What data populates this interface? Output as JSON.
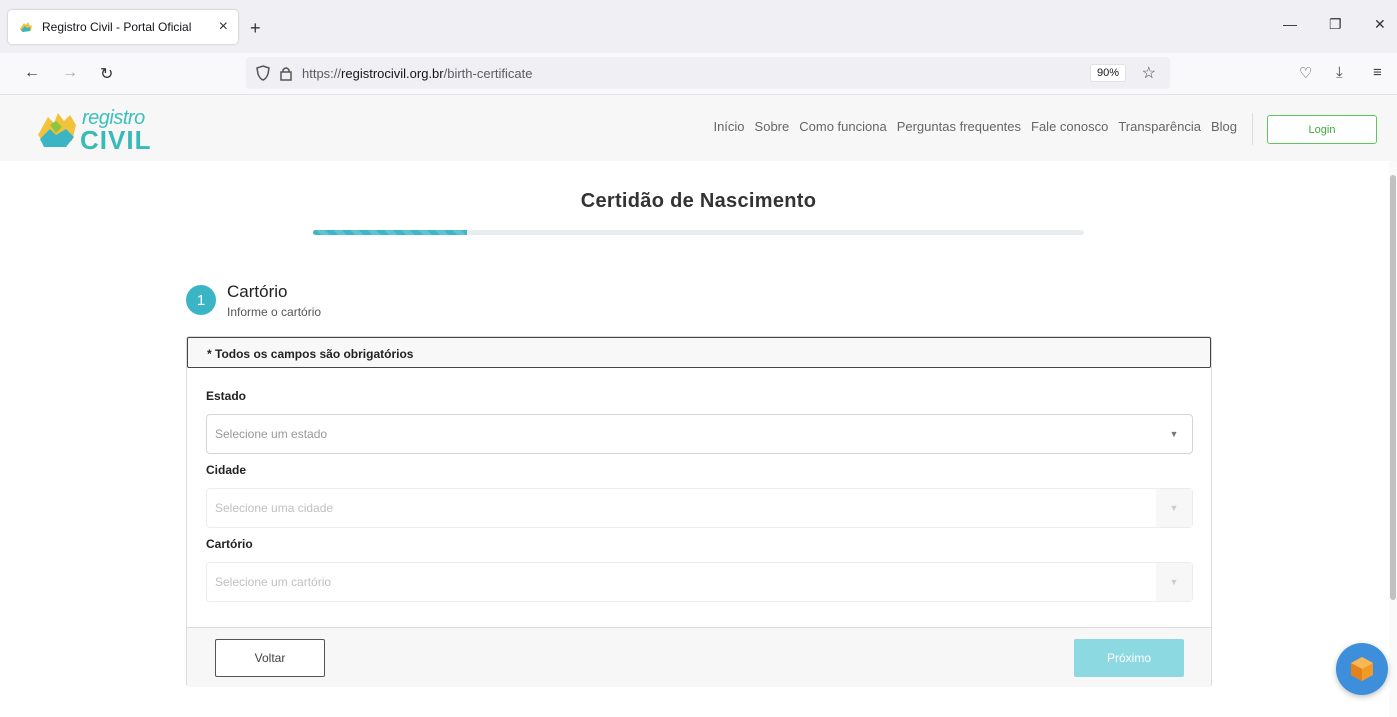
{
  "browser": {
    "tab_title": "Registro Civil - Portal Oficial",
    "tab_close": "×",
    "new_tab": "+",
    "url_prefix": "https://",
    "url_host": "registrocivil.org.br",
    "url_path": "/birth-certificate",
    "zoom": "90%"
  },
  "header": {
    "logo_top": "registro",
    "logo_bottom": "CIVIL",
    "nav": [
      "Início",
      "Sobre",
      "Como funciona",
      "Perguntas frequentes",
      "Fale conosco",
      "Transparência",
      "Blog"
    ],
    "login": "Login"
  },
  "page": {
    "title": "Certidão de Nascimento",
    "progress_fraction": 0.2
  },
  "step": {
    "number": "1",
    "title": "Cartório",
    "subtitle": "Informe o cartório"
  },
  "form": {
    "required_note": "* Todos os campos são obrigatórios",
    "estado_label": "Estado",
    "estado_placeholder": "Selecione um estado",
    "cidade_label": "Cidade",
    "cidade_placeholder": "Selecione uma cidade",
    "cartorio_label": "Cartório",
    "cartorio_placeholder": "Selecione um cartório",
    "back": "Voltar",
    "next": "Próximo"
  },
  "colors": {
    "accent": "#3bb5c6",
    "login_green": "#5cc85c",
    "next_button": "#8dd9e2"
  }
}
